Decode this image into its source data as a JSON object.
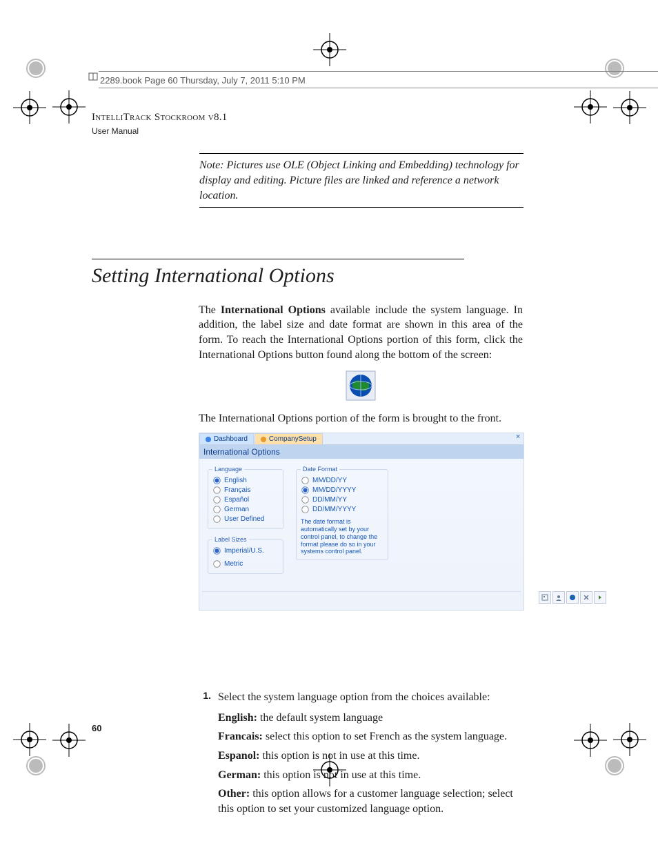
{
  "crop_header": "2289.book  Page 60  Thursday, July 7, 2011  5:10 PM",
  "running_head": {
    "title": "IntelliTrack Stockroom v8.1",
    "sub": "User Manual"
  },
  "note_text": "Note:   Pictures use OLE (Object Linking and Embedding) technology for display and editing. Picture files are linked and reference a network location.",
  "section_title": "Setting International Options",
  "intro_before_bold": "The ",
  "intro_bold": "International Options",
  "intro_after_bold": " available include the system language. In addition, the label size and date format are shown in this area of the form. To reach the International Options portion of this form, click the International Options button found along the bottom of the screen:",
  "after_globe": "The International Options portion of the form is brought to the front.",
  "screenshot": {
    "tabs": {
      "dashboard": "Dashboard",
      "company": "CompanySetup"
    },
    "headbar": "International Options",
    "language_legend": "Language",
    "languages": [
      "English",
      "Français",
      "Español",
      "German",
      "User Defined"
    ],
    "language_selected": "English",
    "label_sizes_legend": "Label Sizes",
    "label_size_options": [
      "Imperial/U.S.",
      "Metric"
    ],
    "label_size_selected": "Imperial/U.S.",
    "date_legend": "Date Format",
    "date_formats": [
      "MM/DD/YY",
      "MM/DD/YYYY",
      "DD/MM/YY",
      "DD/MM/YYYY"
    ],
    "date_selected": "MM/DD/YYYY",
    "date_note": "The date format is automatically set by your control panel, to change the format please do so in your systems control panel."
  },
  "list": {
    "number": "1.",
    "lead": "Select the system language option from the choices available:",
    "items": [
      {
        "b": "English:",
        "t": " the default system language"
      },
      {
        "b": "Francais:",
        "t": " select this option to set French as the system language."
      },
      {
        "b": "Espanol:",
        "t": " this option is not in use at this time."
      },
      {
        "b": "German:",
        "t": " this option is not in use at this time."
      },
      {
        "b": "Other:",
        "t": " this option allows for a customer language selection; select this option to set your customized language option."
      }
    ]
  },
  "page_number": "60"
}
